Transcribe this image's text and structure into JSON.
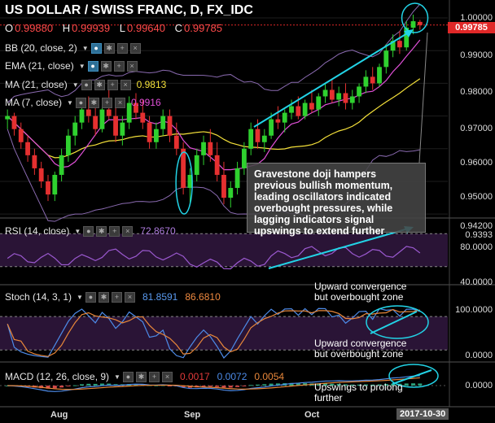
{
  "header": {
    "title": "US DOLLAR / SWISS FRANC, D, FX_IDC",
    "ohlc": [
      {
        "key": "O",
        "value": "0.99880"
      },
      {
        "key": "H",
        "value": "0.99939"
      },
      {
        "key": "L",
        "value": "0.99640"
      },
      {
        "key": "C",
        "value": "0.99785"
      }
    ]
  },
  "indicators": {
    "bb": {
      "label": "BB (20, close, 2)"
    },
    "ema": {
      "label": "EMA (21, close)"
    },
    "ma21": {
      "label": "MA (21, close)",
      "value": "0.9813",
      "color": "#f5e13a"
    },
    "ma7": {
      "label": "MA (7, close)",
      "value": "0.9916",
      "color": "#e050d8"
    },
    "rsi": {
      "label": "RSI (14, close)",
      "value": "72.8670"
    },
    "stoch": {
      "label": "Stoch (14, 3, 1)",
      "k": "81.8591",
      "d": "86.6810"
    },
    "macd": {
      "label": "MACD (12, 26, close, 9)",
      "v1": "0.0017",
      "v2": "0.0072",
      "v3": "0.0054"
    }
  },
  "annotations": {
    "main_note": "Gravestone doji hampers previous bullish momentum, leading oscillators indicated overbought pressures, while lagging indicators signal upswings to extend further",
    "rsi_note": "Upward convergence but overbought zone",
    "stoch_note": "Upward convergence but overbought zone",
    "macd_note": "Upswings to prolong further"
  },
  "price_axis": {
    "ticks": [
      "1.00000",
      "0.99000",
      "0.98000",
      "0.97000",
      "0.96000",
      "0.95000",
      "0.94200"
    ],
    "last_price": "0.99785",
    "partial_label": "0.9393"
  },
  "rsi_axis": {
    "ticks": [
      "80.0000",
      "40.0000"
    ]
  },
  "stoch_axis": {
    "ticks": [
      "100.0000",
      "0.0000"
    ]
  },
  "macd_axis": {
    "ticks": [
      "0.0000"
    ]
  },
  "time_axis": {
    "labels": [
      "Aug",
      "Sep",
      "Oct"
    ],
    "last_date": "2017-10-30"
  },
  "colors": {
    "up": "#2fd12f",
    "down": "#e53030",
    "cyan": "#22d3e6",
    "ma21": "#f5e13a",
    "ma7": "#e050d8",
    "bb": "#8a6ab0",
    "rsi": "#9b59d0",
    "stochK": "#4d8be8",
    "stochD": "#e8873a",
    "macd": "#4d8be8",
    "signal": "#e8873a"
  },
  "chart_data": {
    "type": "candlestick",
    "title": "US DOLLAR / SWISS FRANC, D, FX_IDC",
    "ylim": [
      0.9393,
      1.003
    ],
    "candles": [
      [
        0.969,
        0.972,
        0.966,
        0.97
      ],
      [
        0.97,
        0.971,
        0.964,
        0.966
      ],
      [
        0.966,
        0.968,
        0.96,
        0.962
      ],
      [
        0.962,
        0.964,
        0.956,
        0.958
      ],
      [
        0.958,
        0.96,
        0.952,
        0.954
      ],
      [
        0.954,
        0.956,
        0.948,
        0.95
      ],
      [
        0.95,
        0.952,
        0.944,
        0.946
      ],
      [
        0.946,
        0.953,
        0.944,
        0.952
      ],
      [
        0.952,
        0.96,
        0.95,
        0.958
      ],
      [
        0.958,
        0.966,
        0.956,
        0.964
      ],
      [
        0.964,
        0.97,
        0.961,
        0.968
      ],
      [
        0.968,
        0.974,
        0.966,
        0.972
      ],
      [
        0.972,
        0.976,
        0.968,
        0.97
      ],
      [
        0.97,
        0.974,
        0.964,
        0.966
      ],
      [
        0.966,
        0.973,
        0.965,
        0.972
      ],
      [
        0.972,
        0.978,
        0.969,
        0.97
      ],
      [
        0.97,
        0.973,
        0.962,
        0.964
      ],
      [
        0.964,
        0.97,
        0.961,
        0.968
      ],
      [
        0.968,
        0.976,
        0.966,
        0.974
      ],
      [
        0.974,
        0.977,
        0.969,
        0.971
      ],
      [
        0.971,
        0.975,
        0.966,
        0.968
      ],
      [
        0.968,
        0.97,
        0.96,
        0.962
      ],
      [
        0.962,
        0.968,
        0.96,
        0.966
      ],
      [
        0.966,
        0.972,
        0.964,
        0.97
      ],
      [
        0.97,
        0.972,
        0.962,
        0.964
      ],
      [
        0.964,
        0.968,
        0.958,
        0.96
      ],
      [
        0.96,
        0.962,
        0.946,
        0.948
      ],
      [
        0.948,
        0.954,
        0.943,
        0.952
      ],
      [
        0.952,
        0.96,
        0.95,
        0.958
      ],
      [
        0.958,
        0.964,
        0.955,
        0.962
      ],
      [
        0.962,
        0.966,
        0.956,
        0.958
      ],
      [
        0.958,
        0.962,
        0.95,
        0.952
      ],
      [
        0.952,
        0.956,
        0.943,
        0.945
      ],
      [
        0.945,
        0.95,
        0.942,
        0.948
      ],
      [
        0.948,
        0.956,
        0.946,
        0.954
      ],
      [
        0.954,
        0.962,
        0.952,
        0.96
      ],
      [
        0.96,
        0.968,
        0.958,
        0.966
      ],
      [
        0.966,
        0.969,
        0.96,
        0.962
      ],
      [
        0.962,
        0.966,
        0.959,
        0.964
      ],
      [
        0.964,
        0.971,
        0.963,
        0.969
      ],
      [
        0.969,
        0.973,
        0.966,
        0.968
      ],
      [
        0.968,
        0.972,
        0.965,
        0.971
      ],
      [
        0.971,
        0.975,
        0.969,
        0.973
      ],
      [
        0.973,
        0.976,
        0.969,
        0.97
      ],
      [
        0.97,
        0.975,
        0.969,
        0.974
      ],
      [
        0.974,
        0.978,
        0.971,
        0.972
      ],
      [
        0.972,
        0.977,
        0.97,
        0.976
      ],
      [
        0.976,
        0.98,
        0.974,
        0.978
      ],
      [
        0.978,
        0.981,
        0.974,
        0.975
      ],
      [
        0.975,
        0.979,
        0.973,
        0.977
      ],
      [
        0.977,
        0.98,
        0.972,
        0.974
      ],
      [
        0.974,
        0.978,
        0.972,
        0.976
      ],
      [
        0.976,
        0.98,
        0.974,
        0.979
      ],
      [
        0.979,
        0.984,
        0.977,
        0.982
      ],
      [
        0.982,
        0.985,
        0.978,
        0.98
      ],
      [
        0.98,
        0.986,
        0.979,
        0.985
      ],
      [
        0.985,
        0.992,
        0.983,
        0.99
      ],
      [
        0.99,
        0.995,
        0.988,
        0.993
      ],
      [
        0.993,
        0.996,
        0.989,
        0.991
      ],
      [
        0.991,
        0.999,
        0.99,
        0.997
      ],
      [
        0.997,
        1.001,
        0.995,
        0.999
      ],
      [
        0.9988,
        0.99939,
        0.9964,
        0.99785
      ]
    ]
  }
}
